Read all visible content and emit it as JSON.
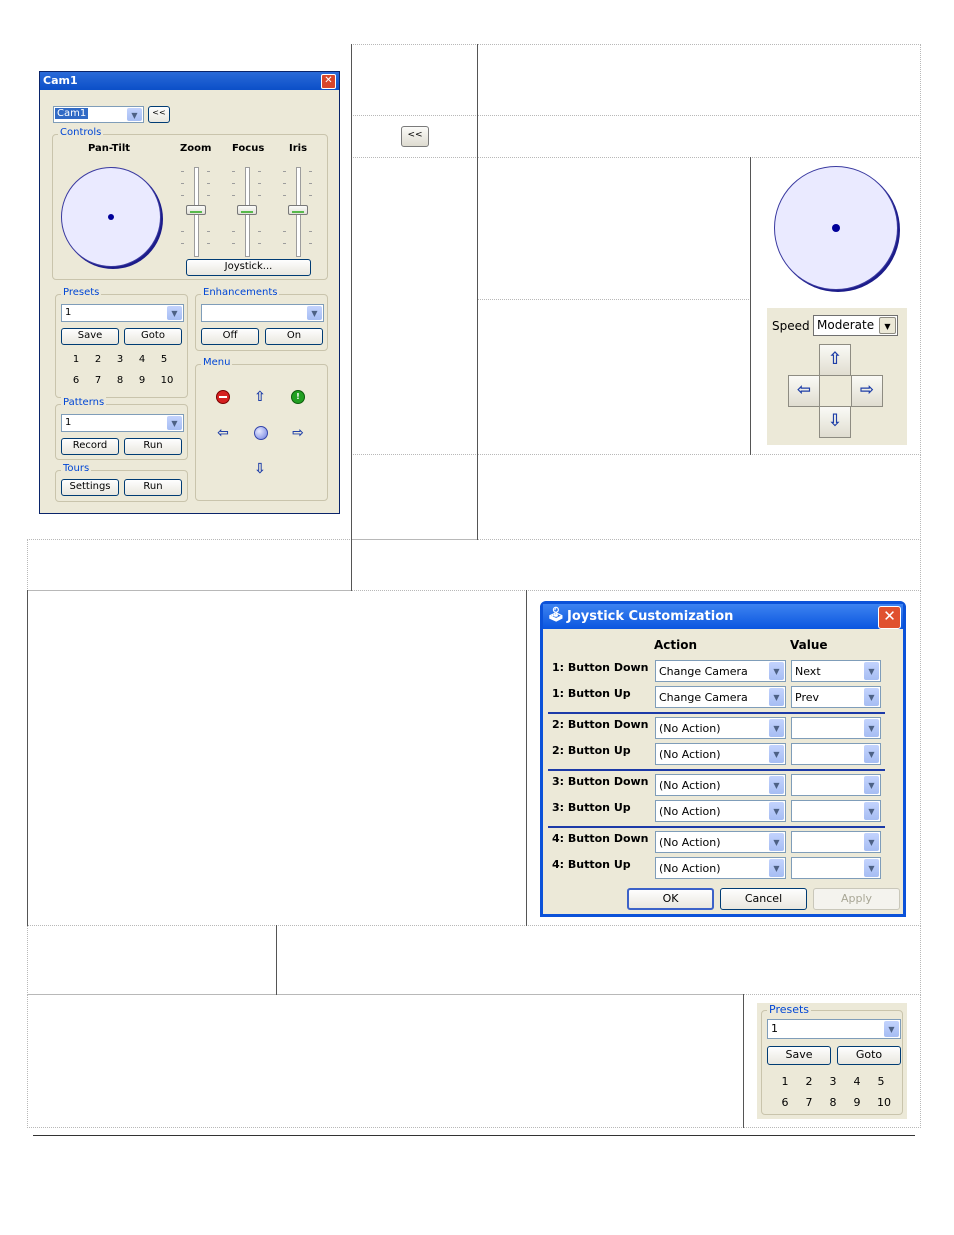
{
  "cam_window": {
    "title": "Cam1",
    "close": "✕",
    "camera_select": "Cam1",
    "collapse_button": "<<",
    "controls": {
      "group_label": "Controls",
      "pan_tilt_label": "Pan-Tilt",
      "zoom_label": "Zoom",
      "focus_label": "Focus",
      "iris_label": "Iris",
      "joystick_button": "Joystick..."
    },
    "presets": {
      "group_label": "Presets",
      "selected": "1",
      "save_button": "Save",
      "goto_button": "Goto",
      "numbers_row1": [
        "1",
        "2",
        "3",
        "4",
        "5"
      ],
      "numbers_row2": [
        "6",
        "7",
        "8",
        "9",
        "10"
      ]
    },
    "enhancements": {
      "group_label": "Enhancements",
      "selected": "",
      "off_button": "Off",
      "on_button": "On"
    },
    "menu": {
      "group_label": "Menu",
      "icons": [
        "stop-icon",
        "up-arrow-icon",
        "go-icon",
        "left-arrow-icon",
        "home-icon",
        "right-arrow-icon",
        "down-arrow-icon"
      ]
    },
    "patterns": {
      "group_label": "Patterns",
      "selected": "1",
      "record_button": "Record",
      "run_button": "Run"
    },
    "tours": {
      "group_label": "Tours",
      "settings_button": "Settings",
      "run_button": "Run"
    }
  },
  "inline_collapse_button": "<<",
  "speed_panel": {
    "speed_label": "Speed",
    "speed_value": "Moderate",
    "up": "⇧",
    "left": "⇦",
    "right": "⇨",
    "down": "⇩"
  },
  "joystick_dialog": {
    "title": "Joystick Customization",
    "close": "✕",
    "action_header": "Action",
    "value_header": "Value",
    "rows": [
      {
        "label": "1: Button Down",
        "action": "Change Camera",
        "value": "Next"
      },
      {
        "label": "1: Button Up",
        "action": "Change Camera",
        "value": "Prev"
      },
      {
        "label": "2: Button Down",
        "action": "(No Action)",
        "value": ""
      },
      {
        "label": "2: Button Up",
        "action": "(No Action)",
        "value": ""
      },
      {
        "label": "3: Button Down",
        "action": "(No Action)",
        "value": ""
      },
      {
        "label": "3: Button Up",
        "action": "(No Action)",
        "value": ""
      },
      {
        "label": "4: Button Down",
        "action": "(No Action)",
        "value": ""
      },
      {
        "label": "4: Button Up",
        "action": "(No Action)",
        "value": ""
      }
    ],
    "ok_button": "OK",
    "cancel_button": "Cancel",
    "apply_button": "Apply"
  },
  "presets_panel": {
    "group_label": "Presets",
    "selected": "1",
    "save_button": "Save",
    "goto_button": "Goto",
    "numbers_row1": [
      "1",
      "2",
      "3",
      "4",
      "5"
    ],
    "numbers_row2": [
      "6",
      "7",
      "8",
      "9",
      "10"
    ]
  },
  "colors": {
    "title_bar": "#0b4fc8",
    "window_bg": "#ece9d8",
    "group_label": "#0046d5",
    "arrow_blue": "#1f3fa8",
    "close_red": "#d8462b"
  }
}
